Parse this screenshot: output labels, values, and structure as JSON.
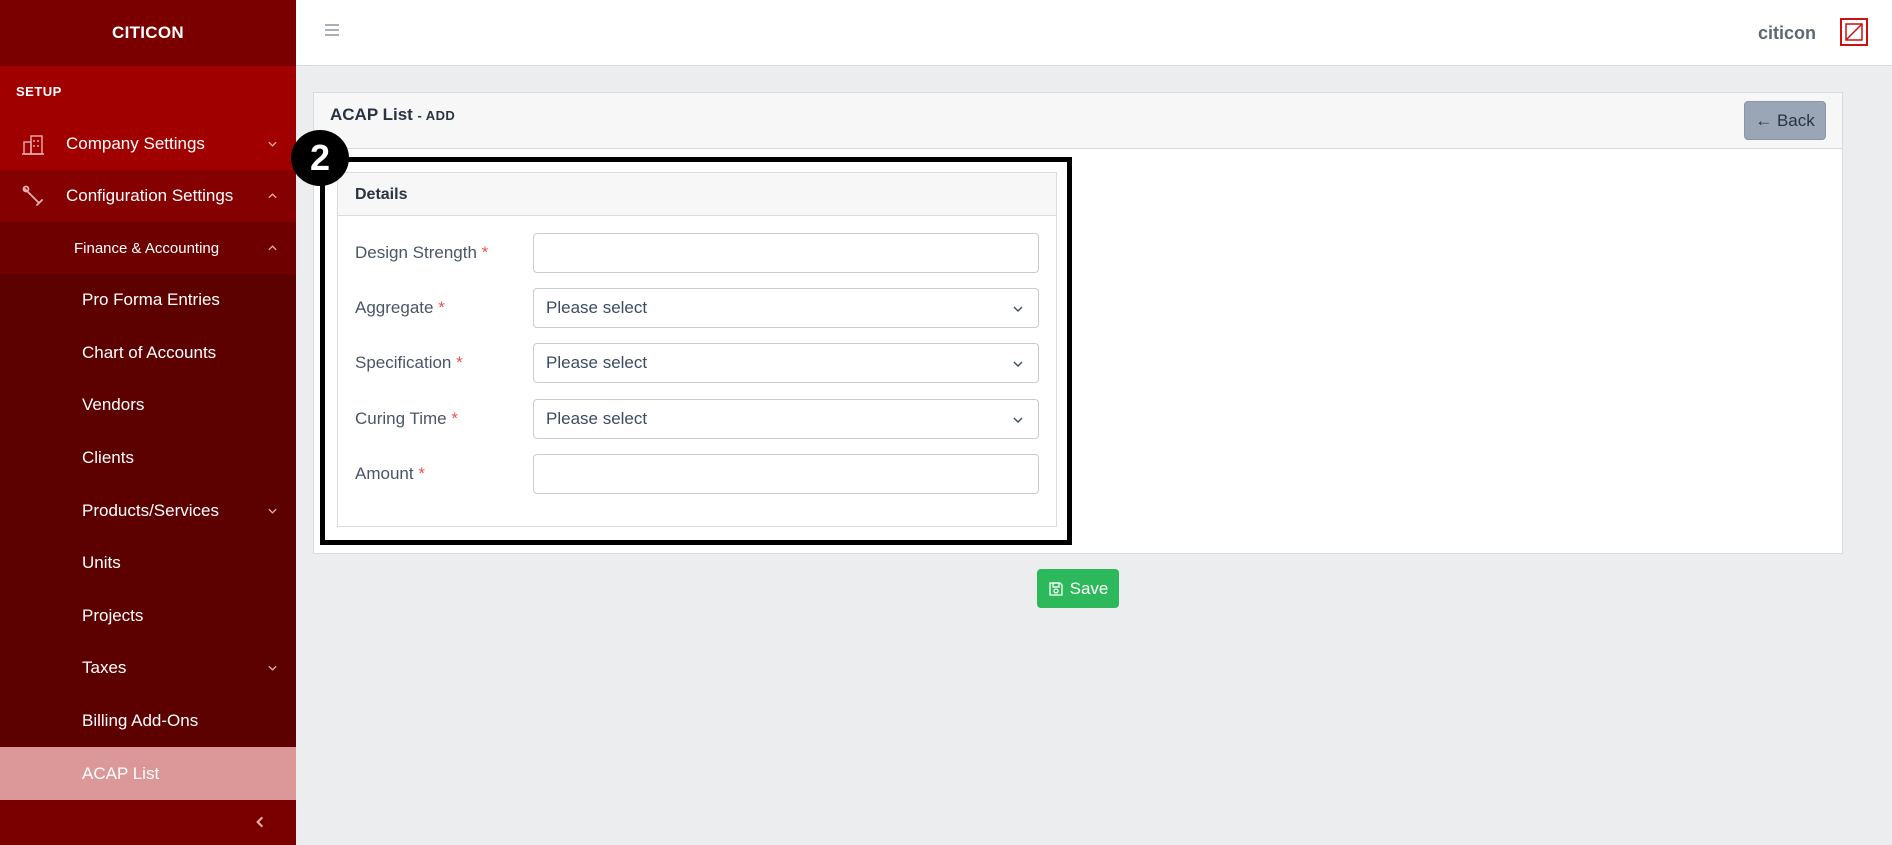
{
  "sidebar": {
    "brand": "CITICON",
    "section_title": "SETUP",
    "company_settings": "Company Settings",
    "configuration_settings": "Configuration Settings",
    "finance_accounting": "Finance & Accounting",
    "items": [
      {
        "label": "Pro Forma Entries"
      },
      {
        "label": "Chart of Accounts"
      },
      {
        "label": "Vendors"
      },
      {
        "label": "Clients"
      },
      {
        "label": "Products/Services"
      },
      {
        "label": "Units"
      },
      {
        "label": "Projects"
      },
      {
        "label": "Taxes"
      },
      {
        "label": "Billing Add-Ons"
      },
      {
        "label": "ACAP List"
      }
    ]
  },
  "header": {
    "username": "citicon"
  },
  "page": {
    "title": "ACAP List",
    "subtitle": "- ADD",
    "back_label": "← Back",
    "step_number": "2"
  },
  "details": {
    "title": "Details",
    "fields": [
      {
        "label": "Design Strength",
        "required": "*",
        "value": ""
      },
      {
        "label": "Aggregate",
        "required": "*",
        "value": "Please select"
      },
      {
        "label": "Specification",
        "required": "*",
        "value": "Please select"
      },
      {
        "label": "Curing Time",
        "required": "*",
        "value": "Please select"
      },
      {
        "label": "Amount",
        "required": "*",
        "value": ""
      }
    ]
  },
  "save_label": "Save",
  "colors": {
    "sidebar_bg": "#5c0000",
    "sidebar_highlight": "#a00000",
    "active_item": "#dc9799",
    "save_green": "#2eb85c",
    "back_gray": "#9aa5b5",
    "required_red": "#e55353"
  }
}
